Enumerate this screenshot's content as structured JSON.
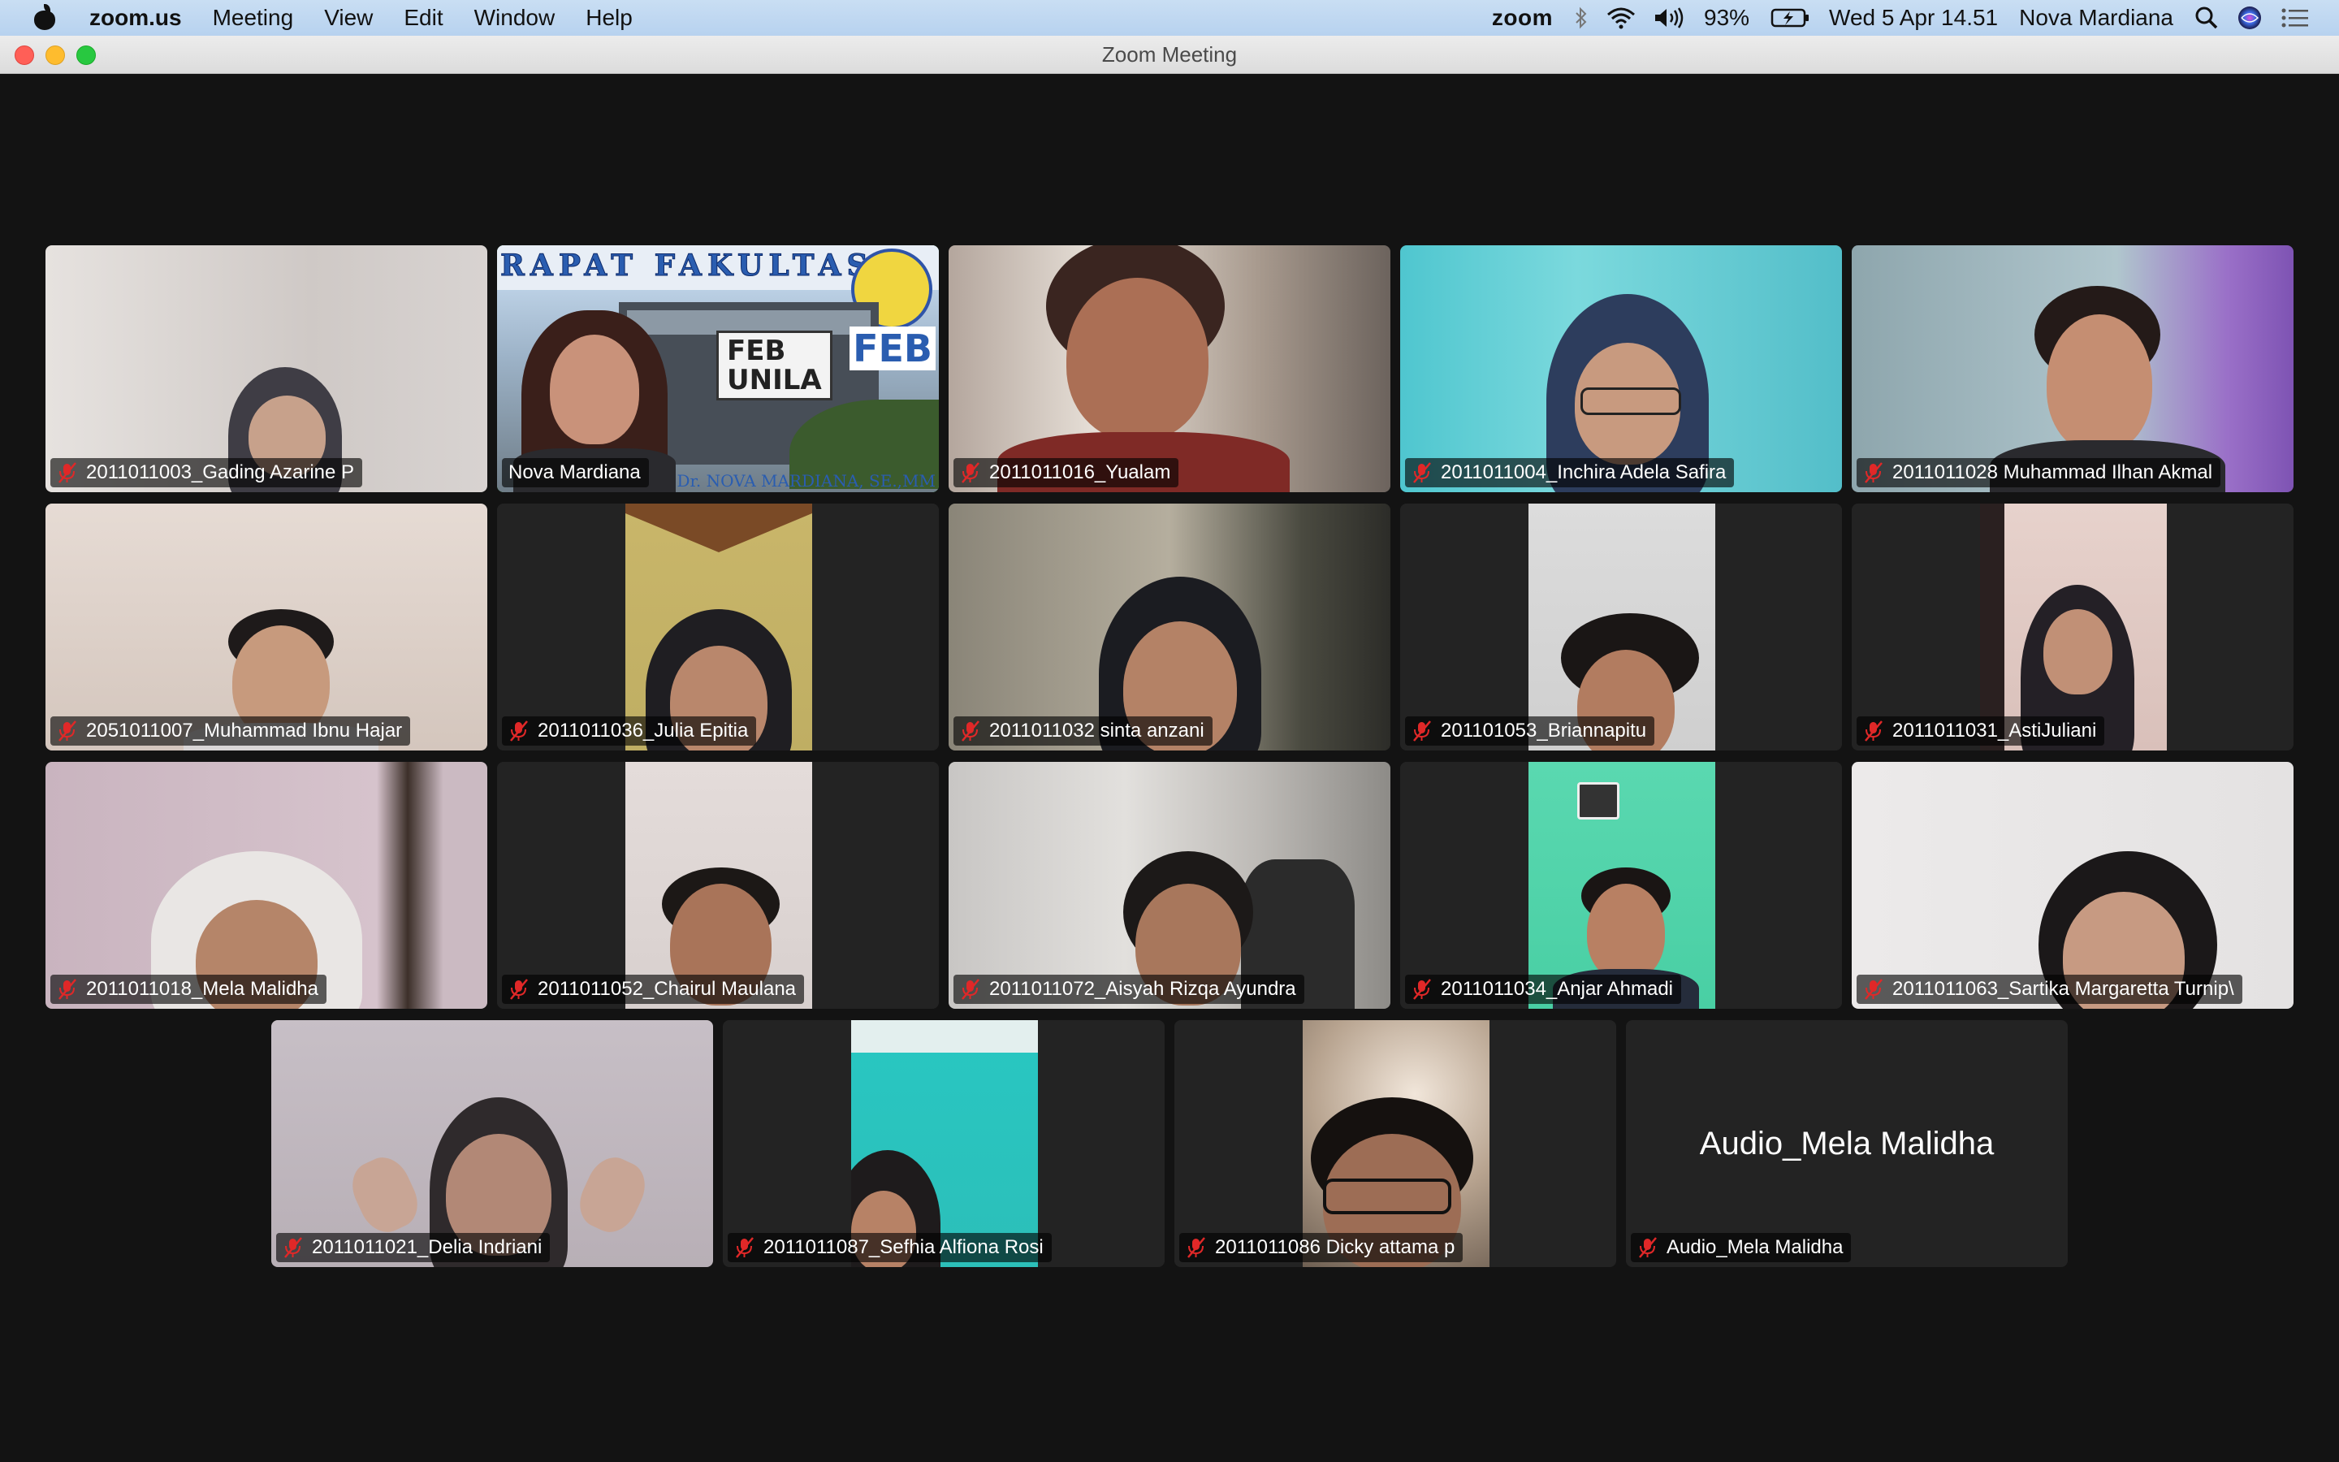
{
  "menubar": {
    "app": "zoom.us",
    "menus": [
      "Meeting",
      "View",
      "Edit",
      "Window",
      "Help"
    ],
    "zoom_logo": "zoom",
    "battery": "93%",
    "datetime": "Wed 5 Apr  14.51",
    "user": "Nova Mardiana",
    "icons": [
      "apple-icon",
      "bluetooth-icon",
      "wifi-icon",
      "volume-icon",
      "battery-icon",
      "search-icon",
      "siri-icon",
      "control-center-icon"
    ]
  },
  "window": {
    "title": "Zoom Meeting"
  },
  "host_banner": {
    "heading": "RAPAT FAKULTAS",
    "sign": "FEB\nUNILA",
    "logo_text": "FEB",
    "footer": "Dr. NOVA MARDIANA, SE.,MM"
  },
  "participants": [
    {
      "name": "2011011003_Gading Azarine P",
      "muted": true
    },
    {
      "name": "Nova Mardiana",
      "muted": false
    },
    {
      "name": "2011011016_Yualam",
      "muted": true
    },
    {
      "name": "2011011004_Inchira Adela Safira",
      "muted": true
    },
    {
      "name": "2011011028 Muhammad Ilhan Akmal",
      "muted": true
    },
    {
      "name": "2051011007_Muhammad Ibnu Hajar",
      "muted": true
    },
    {
      "name": "2011011036_Julia Epitia",
      "muted": true
    },
    {
      "name": "2011011032 sinta anzani",
      "muted": true
    },
    {
      "name": "201101053_Briannapitu",
      "muted": true
    },
    {
      "name": "2011011031_AstiJuliani",
      "muted": true
    },
    {
      "name": "2011011018_Mela Malidha",
      "muted": true
    },
    {
      "name": "2011011052_Chairul Maulana",
      "muted": true
    },
    {
      "name": "2011011072_Aisyah Rizqa Ayundra",
      "muted": true
    },
    {
      "name": "2011011034_Anjar Ahmadi",
      "muted": true
    },
    {
      "name": "2011011063_Sartika Margaretta Turnip\\",
      "muted": true
    },
    {
      "name": "2011011021_Delia Indriani",
      "muted": true
    },
    {
      "name": "2011011087_Sefhia Alfiona Rosi",
      "muted": true
    },
    {
      "name": "2011011086 Dicky attama p",
      "muted": true
    },
    {
      "name": "Audio_Mela Malidha",
      "muted": true,
      "audio_only": true
    }
  ]
}
